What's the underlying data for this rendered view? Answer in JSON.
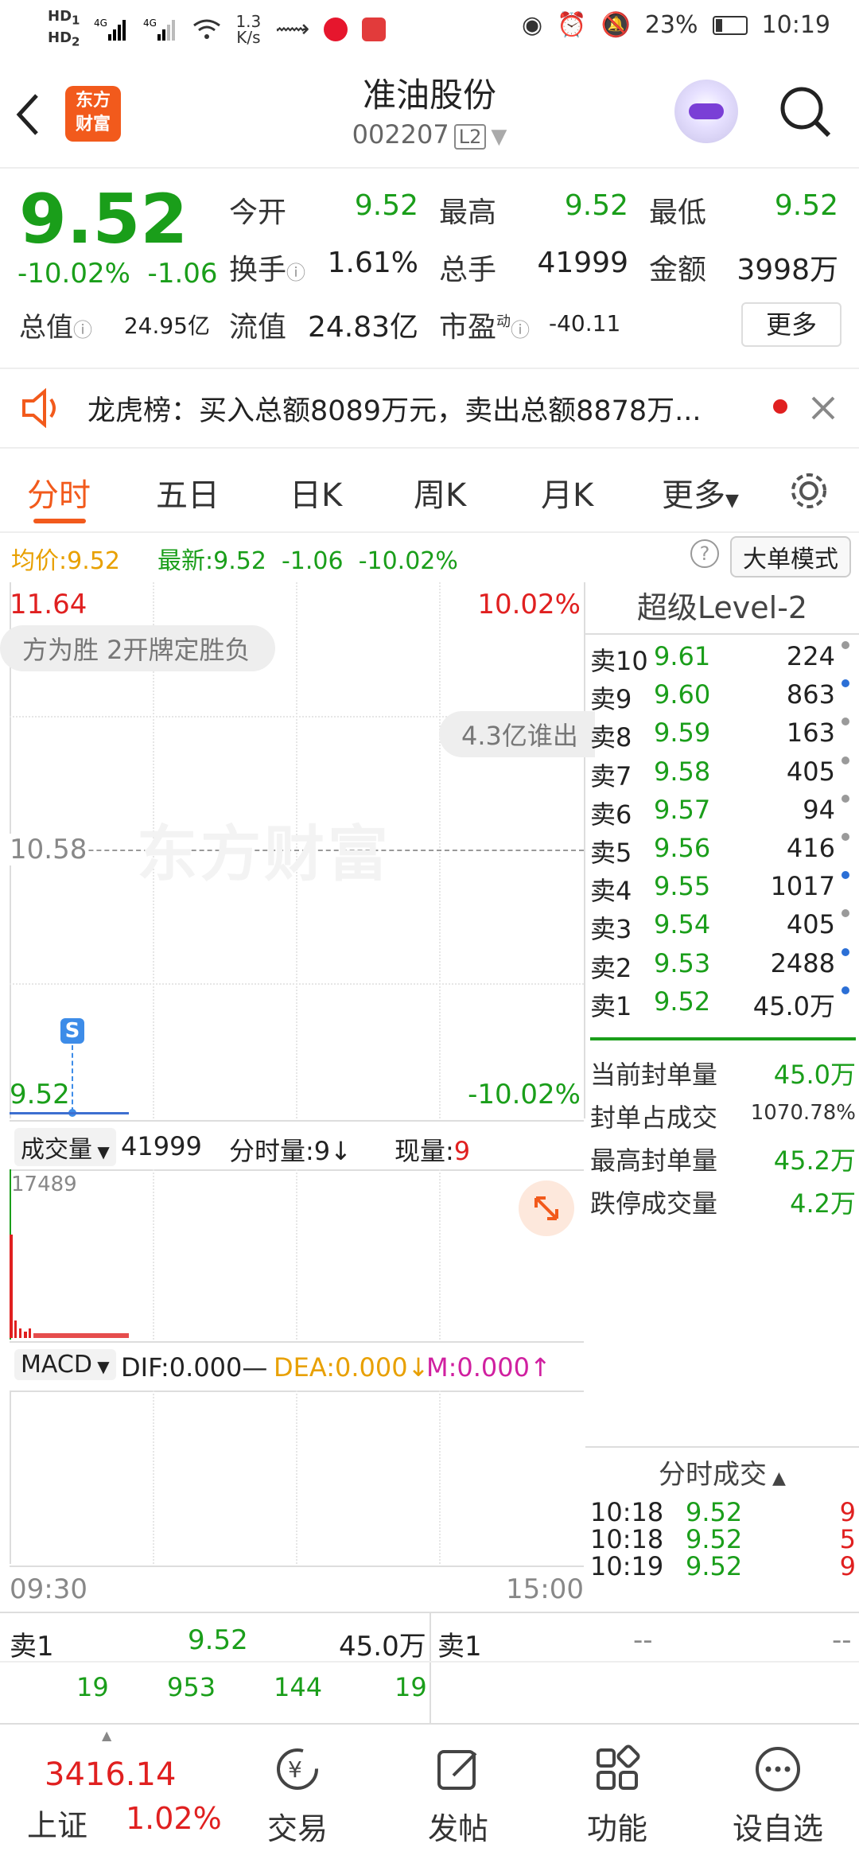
{
  "status_bar": {
    "net_speed": "1.3",
    "net_unit": "K/s",
    "battery": "23%",
    "time": "10:19"
  },
  "header": {
    "logo_text_1": "东方",
    "logo_text_2": "财富",
    "title": "准油股份",
    "code": "002207",
    "level_badge": "L2"
  },
  "quote": {
    "price": "9.52",
    "change_pct": "-10.02%",
    "change_amt": "-1.06",
    "open_label": "今开",
    "open": "9.52",
    "high_label": "最高",
    "high": "9.52",
    "low_label": "最低",
    "low": "9.52",
    "turnover_label": "换手",
    "turnover": "1.61%",
    "volume_label": "总手",
    "volume": "41999",
    "amount_label": "金额",
    "amount": "3998万",
    "mktcap_label": "总值",
    "mktcap": "24.95亿",
    "float_label": "流值",
    "float": "24.83亿",
    "pe_label": "市盈",
    "pe_sup": "动",
    "pe": "-40.11",
    "more_button": "更多"
  },
  "notice": {
    "text": "龙虎榜：买入总额8089万元，卖出总额8878万..."
  },
  "tabs": [
    "分时",
    "五日",
    "日K",
    "周K",
    "月K",
    "更多"
  ],
  "infobar": {
    "avg_label": "均价:",
    "avg": "9.52",
    "latest_label": "最新:",
    "latest": "9.52",
    "latest_chg": "-1.06",
    "latest_pct": "-10.02%",
    "help": "?",
    "mode_button": "大单模式"
  },
  "chart": {
    "top_price": "11.64",
    "top_pct": "10.02%",
    "mid_price": "10.58",
    "bottom_price": "9.52",
    "bottom_pct": "-10.02%",
    "bubble_1": "方为胜 2开牌定胜负",
    "bubble_2": "4.3亿谁出",
    "watermark": "东方财富",
    "marker": "S"
  },
  "orderbook": {
    "title": "超级Level-2",
    "asks": [
      {
        "label": "卖10",
        "price": "9.61",
        "vol": "224",
        "dot": "#9a9a9a"
      },
      {
        "label": "卖9",
        "price": "9.60",
        "vol": "863",
        "dot": "#2b6fd6"
      },
      {
        "label": "卖8",
        "price": "9.59",
        "vol": "163",
        "dot": "#9a9a9a"
      },
      {
        "label": "卖7",
        "price": "9.58",
        "vol": "405",
        "dot": "#9a9a9a"
      },
      {
        "label": "卖6",
        "price": "9.57",
        "vol": "94",
        "dot": "#9a9a9a"
      },
      {
        "label": "卖5",
        "price": "9.56",
        "vol": "416",
        "dot": "#9a9a9a"
      },
      {
        "label": "卖4",
        "price": "9.55",
        "vol": "1017",
        "dot": "#2b6fd6"
      },
      {
        "label": "卖3",
        "price": "9.54",
        "vol": "405",
        "dot": "#9a9a9a"
      },
      {
        "label": "卖2",
        "price": "9.53",
        "vol": "2488",
        "dot": "#2b6fd6"
      },
      {
        "label": "卖1",
        "price": "9.52",
        "vol": "45.0万",
        "dot": "#2b6fd6"
      }
    ],
    "stats": [
      {
        "label": "当前封单量",
        "value": "45.0万"
      },
      {
        "label": "封单占成交",
        "value": "1070.78%"
      },
      {
        "label": "最高封单量",
        "value": "45.2万"
      },
      {
        "label": "跌停成交量",
        "value": "4.2万"
      }
    ],
    "trades_title": "分时成交",
    "trades": [
      {
        "time": "10:18",
        "price": "9.52",
        "vol": "9"
      },
      {
        "time": "10:18",
        "price": "9.52",
        "vol": "5"
      },
      {
        "time": "10:19",
        "price": "9.52",
        "vol": "9"
      }
    ]
  },
  "volume": {
    "selector": "成交量",
    "total": "41999",
    "per_min_label": "分时量:",
    "per_min": "9",
    "cur_label": "现量:",
    "cur": "9",
    "scale": "17489"
  },
  "macd": {
    "selector": "MACD",
    "dif": "DIF:0.000",
    "dea": "DEA:0.000",
    "m": "M:0.000"
  },
  "time_axis": {
    "start": "09:30",
    "end": "15:00"
  },
  "strip": {
    "left_label": "卖1",
    "left_price": "9.52",
    "left_vol": "45.0万",
    "right_label": "卖1",
    "right_price": "--",
    "right_vol": "--",
    "nums": [
      "19",
      "953",
      "144",
      "19"
    ]
  },
  "nav": {
    "index_value": "3416.14",
    "index_name": "上证",
    "index_pct": "1.02%",
    "items": [
      "交易",
      "发帖",
      "功能",
      "设自选"
    ]
  }
}
